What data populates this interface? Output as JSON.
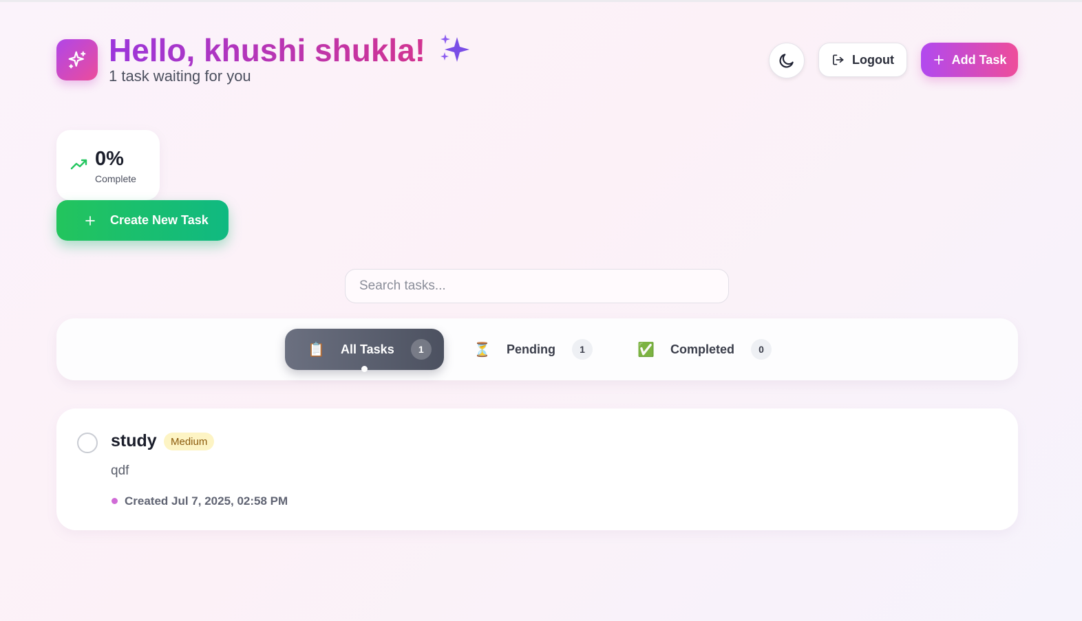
{
  "header": {
    "greeting": "Hello, khushi shukla!",
    "greeting_emoji": "✨",
    "subtitle": "1 task waiting for you",
    "logo_icon": "sparkles-icon",
    "theme_toggle_icon": "moon-icon",
    "logout_label": "Logout",
    "logout_icon": "logout-icon",
    "add_task_label": "Add Task",
    "add_task_icon": "plus-icon"
  },
  "stats": {
    "progress_value": "0%",
    "progress_label": "Complete",
    "icon": "trending-up-icon"
  },
  "create_button": {
    "label": "Create New Task",
    "icon": "plus-icon"
  },
  "search": {
    "placeholder": "Search tasks...",
    "value": ""
  },
  "filters": {
    "tabs": [
      {
        "emoji": "📋",
        "label": "All Tasks",
        "count": "1",
        "active": true
      },
      {
        "emoji": "⏳",
        "label": "Pending",
        "count": "1",
        "active": false
      },
      {
        "emoji": "✅",
        "label": "Completed",
        "count": "0",
        "active": false
      }
    ]
  },
  "tasks": [
    {
      "title": "study",
      "priority": "Medium",
      "description": "qdf",
      "created": "Created Jul 7, 2025, 02:58 PM",
      "completed": false
    }
  ],
  "colors": {
    "accent_purple": "#b149ef",
    "accent_pink": "#ee4d9a",
    "success_green": "#10b981",
    "priority_medium_bg": "#fdf4c4",
    "priority_medium_text": "#8b5a0c"
  }
}
